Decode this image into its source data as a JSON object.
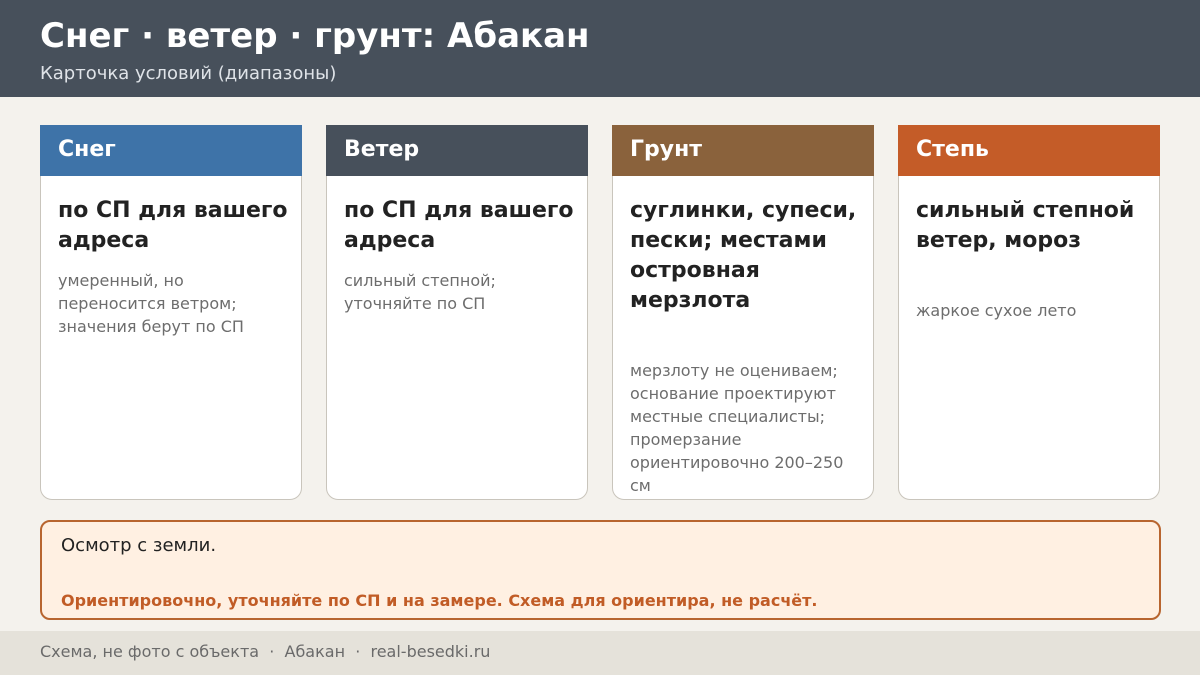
{
  "header": {
    "title": "Снег · ветер · грунт: Абакан",
    "subtitle": "Карточка условий (диапазоны)",
    "color": "#47505b"
  },
  "cards": [
    {
      "label": "Снег",
      "color": "#3e73a8",
      "main": "по СП для вашего адреса",
      "note": "умеренный, но переносится ветром; значения берут по СП"
    },
    {
      "label": "Ветер",
      "color": "#47505b",
      "main": "по СП для вашего адреса",
      "note": "сильный степной; уточняйте по СП"
    },
    {
      "label": "Грунт",
      "color": "#8a623c",
      "main": "суглинки, супеси, пески; местами островная мерзлота",
      "note": "мерзлоту не оцениваем; основание проектируют местные специалисты; промерзание ориентировочно 200–250 см"
    },
    {
      "label": "Степь",
      "color": "#c45c28",
      "main": "сильный степной ветер, мороз",
      "note": "жаркое сухое лето"
    }
  ],
  "note_box": {
    "main": "Осмотр с земли.",
    "warning": "Ориентировочно, уточняйте по СП и на замере. Схема для ориентира, не расчёт."
  },
  "footer": {
    "text": "Схема, не фото с объекта  ·  Абакан  ·  real-besedki.ru"
  }
}
